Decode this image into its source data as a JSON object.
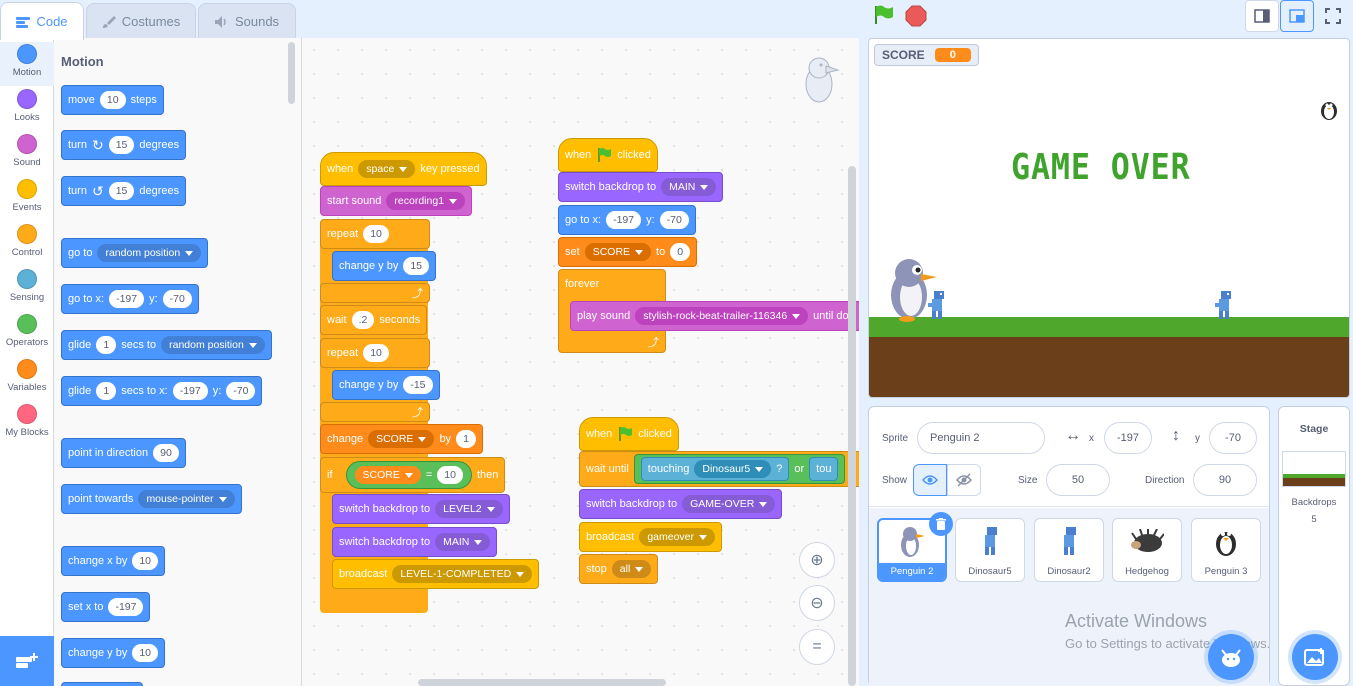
{
  "tabs": {
    "code": "Code",
    "costumes": "Costumes",
    "sounds": "Sounds"
  },
  "categories": [
    {
      "label": "Motion",
      "color": "#4c97ff"
    },
    {
      "label": "Looks",
      "color": "#9966ff"
    },
    {
      "label": "Sound",
      "color": "#cf63cf"
    },
    {
      "label": "Events",
      "color": "#ffbf00"
    },
    {
      "label": "Control",
      "color": "#ffab19"
    },
    {
      "label": "Sensing",
      "color": "#5cb1d6"
    },
    {
      "label": "Operators",
      "color": "#59c059"
    },
    {
      "label": "Variables",
      "color": "#ff8c1a"
    },
    {
      "label": "My Blocks",
      "color": "#ff6680"
    }
  ],
  "palette": {
    "title": "Motion",
    "move": {
      "a": "move",
      "n": "10",
      "b": "steps"
    },
    "turn_cw": {
      "a": "turn",
      "n": "15",
      "b": "degrees"
    },
    "turn_ccw": {
      "a": "turn",
      "n": "15",
      "b": "degrees"
    },
    "goto": {
      "a": "go to",
      "dd": "random position"
    },
    "gotoxy": {
      "a": "go to x:",
      "x": "-197",
      "b": "y:",
      "y": "-70"
    },
    "glide1": {
      "a": "glide",
      "n": "1",
      "b": "secs to",
      "dd": "random position"
    },
    "glide2": {
      "a": "glide",
      "n": "1",
      "b": "secs to x:",
      "x": "-197",
      "c": "y:",
      "y": "-70"
    },
    "point_dir": {
      "a": "point in direction",
      "n": "90"
    },
    "point_towards": {
      "a": "point towards",
      "dd": "mouse-pointer"
    },
    "change_x": {
      "a": "change x by",
      "n": "10"
    },
    "set_x": {
      "a": "set x to",
      "n": "-197"
    },
    "change_y": {
      "a": "change y by",
      "n": "10"
    }
  },
  "script1": {
    "hat": {
      "a": "when",
      "dd": "space",
      "b": "key pressed"
    },
    "start_sound": {
      "a": "start sound",
      "dd": "recording1"
    },
    "repeat1": {
      "a": "repeat",
      "n": "10"
    },
    "change_y1": {
      "a": "change y by",
      "n": "15"
    },
    "wait": {
      "a": "wait",
      "n": ".2",
      "b": "seconds"
    },
    "repeat2": {
      "a": "repeat",
      "n": "10"
    },
    "change_y2": {
      "a": "change y by",
      "n": "-15"
    },
    "change_score": {
      "a": "change",
      "dd": "SCORE",
      "b": "by",
      "n": "1"
    },
    "if": {
      "a": "if",
      "var": "SCORE",
      "op": "=",
      "n": "10",
      "b": "then"
    },
    "backdrop_l2": {
      "a": "switch backdrop to",
      "dd": "LEVEL2"
    },
    "backdrop_main": {
      "a": "switch backdrop to",
      "dd": "MAIN"
    },
    "broadcast": {
      "a": "broadcast",
      "dd": "LEVEL-1-COMPLETED"
    }
  },
  "script2": {
    "hat": {
      "a": "when",
      "b": "clicked"
    },
    "backdrop": {
      "a": "switch backdrop to",
      "dd": "MAIN"
    },
    "gotoxy": {
      "a": "go to x:",
      "x": "-197",
      "b": "y:",
      "y": "-70"
    },
    "set": {
      "a": "set",
      "dd": "SCORE",
      "b": "to",
      "n": "0"
    },
    "forever": {
      "a": "forever"
    },
    "play_sound": {
      "a": "play sound",
      "dd": "stylish-rock-beat-trailer-116346",
      "b": "until do"
    }
  },
  "script3": {
    "hat": {
      "a": "when",
      "b": "clicked"
    },
    "wait_until": {
      "a": "wait until",
      "t": "touching",
      "dd": "Dinosaur5",
      "q": "?",
      "or": "or",
      "t2": "tou"
    },
    "backdrop": {
      "a": "switch backdrop to",
      "dd": "GAME-OVER"
    },
    "broadcast": {
      "a": "broadcast",
      "dd": "gameover"
    },
    "stop": {
      "a": "stop",
      "dd": "all"
    }
  },
  "stage": {
    "score_label": "SCORE",
    "score_value": "0",
    "game_over": "GAME OVER"
  },
  "sprite_info": {
    "sprite_label": "Sprite",
    "sprite_name": "Penguin 2",
    "x_label": "x",
    "x_value": "-197",
    "y_label": "y",
    "y_value": "-70",
    "show_label": "Show",
    "size_label": "Size",
    "size_value": "50",
    "direction_label": "Direction",
    "direction_value": "90"
  },
  "sprites": [
    {
      "name": "Penguin 2",
      "selected": true
    },
    {
      "name": "Dinosaur5"
    },
    {
      "name": "Dinosaur2"
    },
    {
      "name": "Hedgehog"
    },
    {
      "name": "Penguin 3"
    }
  ],
  "stage_pane": {
    "title": "Stage",
    "backdrops_label": "Backdrops",
    "backdrops_count": "5"
  },
  "watermark": {
    "line1": "Activate Windows",
    "line2": "Go to Settings to activate Windows."
  }
}
